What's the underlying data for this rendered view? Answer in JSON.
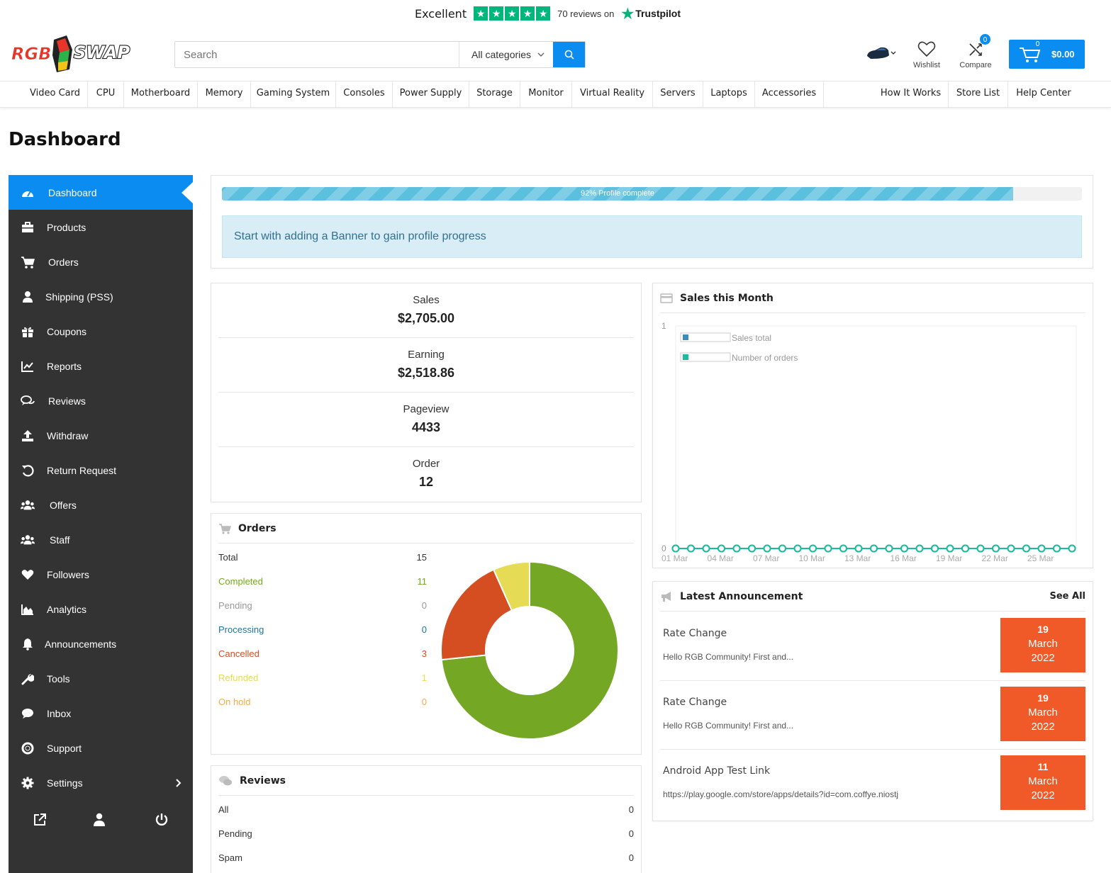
{
  "trustpilot": {
    "rating_word": "Excellent",
    "reviews": "70 reviews on",
    "brand": "Trustpilot"
  },
  "header": {
    "search_placeholder": "Search",
    "category": "All categories",
    "wishlist": "Wishlist",
    "compare": "Compare",
    "compare_count": "0",
    "cart_count": "0",
    "cart_total": "$0.00"
  },
  "nav": {
    "left": [
      "Video Card",
      "CPU",
      "Motherboard",
      "Memory",
      "Gaming System",
      "Consoles",
      "Power Supply",
      "Storage",
      "Monitor",
      "Virtual Reality",
      "Servers",
      "Laptops",
      "Accessories"
    ],
    "right": [
      "How It Works",
      "Store List",
      "Help Center"
    ]
  },
  "page_title": "Dashboard",
  "sidebar": {
    "items": [
      {
        "label": "Dashboard",
        "icon": "dashboard-icon"
      },
      {
        "label": "Products",
        "icon": "briefcase-icon"
      },
      {
        "label": "Orders",
        "icon": "cart-icon"
      },
      {
        "label": "Shipping (PSS)",
        "icon": "user-icon"
      },
      {
        "label": "Coupons",
        "icon": "gift-icon"
      },
      {
        "label": "Reports",
        "icon": "chart-line-icon"
      },
      {
        "label": "Reviews",
        "icon": "comments-icon"
      },
      {
        "label": "Withdraw",
        "icon": "upload-icon"
      },
      {
        "label": "Return Request",
        "icon": "undo-icon"
      },
      {
        "label": "Offers",
        "icon": "users-icon"
      },
      {
        "label": "Staff",
        "icon": "users-icon"
      },
      {
        "label": "Followers",
        "icon": "heart-icon"
      },
      {
        "label": "Analytics",
        "icon": "area-chart-icon"
      },
      {
        "label": "Announcements",
        "icon": "bell-icon"
      },
      {
        "label": "Tools",
        "icon": "wrench-icon"
      },
      {
        "label": "Inbox",
        "icon": "comment-icon"
      },
      {
        "label": "Support",
        "icon": "life-ring-icon"
      },
      {
        "label": "Settings",
        "icon": "gear-icon"
      }
    ],
    "footer_icons": [
      "external-link-icon",
      "user-icon",
      "power-icon"
    ]
  },
  "profile": {
    "progress": 0.92,
    "progress_label": "92% Profile complete",
    "notice": "Start with adding a Banner to gain profile progress"
  },
  "stats": [
    {
      "label": "Sales",
      "value": "$2,705.00"
    },
    {
      "label": "Earning",
      "value": "$2,518.86"
    },
    {
      "label": "Pageview",
      "value": "4433"
    },
    {
      "label": "Order",
      "value": "12"
    }
  ],
  "orders_panel": {
    "title": "Orders",
    "rows": [
      {
        "label": "Total",
        "value": "15",
        "color": "#333333"
      },
      {
        "label": "Completed",
        "value": "11",
        "color": "#73a724"
      },
      {
        "label": "Pending",
        "value": "0",
        "color": "#999999"
      },
      {
        "label": "Processing",
        "value": "0",
        "color": "#21759b"
      },
      {
        "label": "Cancelled",
        "value": "3",
        "color": "#d54e21"
      },
      {
        "label": "Refunded",
        "value": "1",
        "color": "#e6db55"
      },
      {
        "label": "On hold",
        "value": "0",
        "color": "#f0ad4e"
      }
    ]
  },
  "chart_data": [
    {
      "type": "pie",
      "variant": "donut",
      "slices": [
        {
          "label": "Completed",
          "value": 11,
          "color": "#73a724"
        },
        {
          "label": "Cancelled",
          "value": 3,
          "color": "#d54e21"
        },
        {
          "label": "Refunded",
          "value": 1,
          "color": "#e6db55"
        }
      ]
    },
    {
      "type": "line",
      "title": "Sales this Month",
      "x": [
        "01 Mar",
        "02 Mar",
        "03 Mar",
        "04 Mar",
        "05 Mar",
        "06 Mar",
        "07 Mar",
        "08 Mar",
        "09 Mar",
        "10 Mar",
        "11 Mar",
        "12 Mar",
        "13 Mar",
        "14 Mar",
        "15 Mar",
        "16 Mar",
        "17 Mar",
        "18 Mar",
        "19 Mar",
        "20 Mar",
        "21 Mar",
        "22 Mar",
        "23 Mar",
        "24 Mar",
        "25 Mar",
        "26 Mar",
        "27 Mar"
      ],
      "x_tick_labels": [
        "01 Mar",
        "04 Mar",
        "07 Mar",
        "10 Mar",
        "13 Mar",
        "16 Mar",
        "19 Mar",
        "22 Mar",
        "25 Mar"
      ],
      "ylim": [
        0,
        1
      ],
      "y_tick_labels": [
        "0",
        "1"
      ],
      "legend_position": "top-left",
      "series": [
        {
          "name": "Sales total",
          "color": "#3c8dbc",
          "values": [
            0,
            0,
            0,
            0,
            0,
            0,
            0,
            0,
            0,
            0,
            0,
            0,
            0,
            0,
            0,
            0,
            0,
            0,
            0,
            0,
            0,
            0,
            0,
            0,
            0,
            0,
            0
          ]
        },
        {
          "name": "Number of orders",
          "color": "#1abc9c",
          "values": [
            0,
            0,
            0,
            0,
            0,
            0,
            0,
            0,
            0,
            0,
            0,
            0,
            0,
            0,
            0,
            0,
            0,
            0,
            0,
            0,
            0,
            0,
            0,
            0,
            0,
            0,
            0
          ]
        }
      ]
    }
  ],
  "sales_panel": {
    "title": "Sales this Month"
  },
  "announcements": {
    "title": "Latest Announcement",
    "see_all": "See All",
    "items": [
      {
        "title": "Rate Change",
        "text": "Hello RGB Community!   First and...",
        "day": "19",
        "month": "March",
        "year": "2022"
      },
      {
        "title": "Rate Change",
        "text": "Hello RGB Community!   First and...",
        "day": "19",
        "month": "March",
        "year": "2022"
      },
      {
        "title": "Android App Test Link",
        "text": "https://play.google.com/store/apps/details?id=com.coffye.niostj",
        "day": "11",
        "month": "March",
        "year": "2022"
      }
    ],
    "date_color": "#f05a28"
  },
  "reviews_panel": {
    "title": "Reviews",
    "rows": [
      {
        "label": "All",
        "value": "0"
      },
      {
        "label": "Pending",
        "value": "0"
      },
      {
        "label": "Spam",
        "value": "0"
      }
    ]
  }
}
